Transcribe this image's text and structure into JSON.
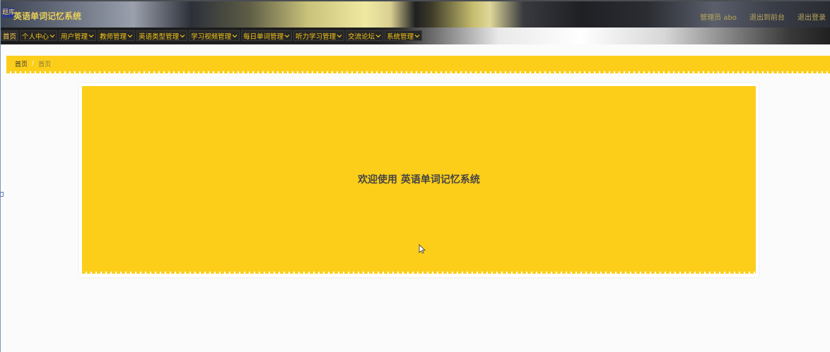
{
  "header": {
    "logo_text": "题库",
    "title": "英语单词记忆系统",
    "links": [
      "管理员 abo",
      "退出到前台",
      "退出登录"
    ]
  },
  "nav": {
    "items": [
      {
        "label": "首页",
        "has_dropdown": false
      },
      {
        "label": "个人中心",
        "has_dropdown": true
      },
      {
        "label": "用户管理",
        "has_dropdown": true
      },
      {
        "label": "教师管理",
        "has_dropdown": true
      },
      {
        "label": "英语类型管理",
        "has_dropdown": true
      },
      {
        "label": "学习视频管理",
        "has_dropdown": true
      },
      {
        "label": "每日单词管理",
        "has_dropdown": true
      },
      {
        "label": "听力学习管理",
        "has_dropdown": true
      },
      {
        "label": "交流论坛",
        "has_dropdown": true
      },
      {
        "label": "系统管理",
        "has_dropdown": true
      }
    ]
  },
  "breadcrumb": {
    "home": "首页",
    "separator": "/",
    "current": "首页"
  },
  "main": {
    "welcome": "欢迎使用 英语单词记忆系统"
  },
  "colors": {
    "accent": "#fcce1a",
    "nav_text": "#f5c518",
    "title": "#e7cf59"
  }
}
